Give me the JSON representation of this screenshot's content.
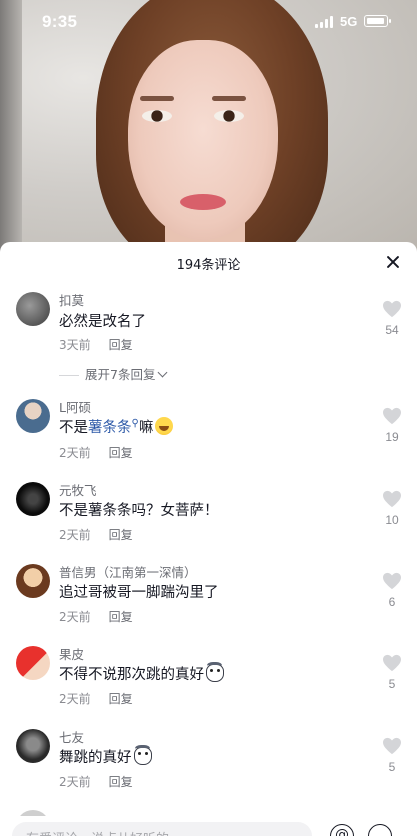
{
  "status": {
    "time": "9:35",
    "network": "5G"
  },
  "sheet": {
    "title": "194条评论"
  },
  "comments": [
    {
      "user": "扣莫",
      "text": "必然是改名了",
      "time": "3天前",
      "reply": "回复",
      "likes": "54",
      "replies_toggle": "展开7条回复"
    },
    {
      "user": "L阿硕",
      "text_prefix": "不是",
      "mention": "薯条条",
      "text_suffix": "嘛",
      "time": "2天前",
      "reply": "回复",
      "likes": "19"
    },
    {
      "user": "元牧飞",
      "text": "不是薯条条吗？女菩萨！",
      "time": "2天前",
      "reply": "回复",
      "likes": "10"
    },
    {
      "user": "普信男（江南第一深情）",
      "text": "追过哥被哥一脚踹沟里了",
      "time": "2天前",
      "reply": "回复",
      "likes": "6"
    },
    {
      "user": "果皮",
      "text": "不得不说那次跳的真好",
      "time": "2天前",
      "reply": "回复",
      "likes": "5"
    },
    {
      "user": "七友",
      "text": "舞跳的真好",
      "time": "2天前",
      "reply": "回复",
      "likes": "5"
    }
  ],
  "input": {
    "placeholder": "有爱评论，说点儿好听的~"
  }
}
